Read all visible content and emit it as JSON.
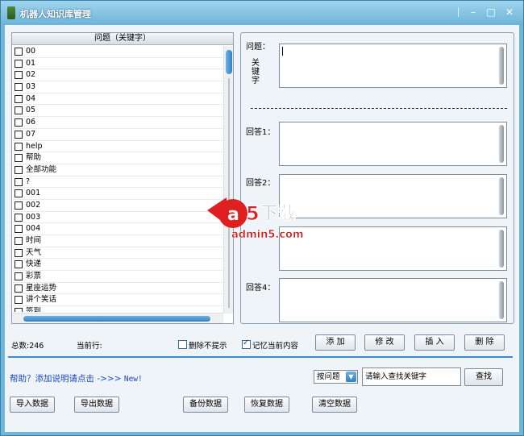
{
  "window": {
    "title": "机器人知识库管理",
    "controls": [
      "–",
      "□",
      "✕"
    ]
  },
  "list": {
    "header": "问题（关键字）",
    "items": [
      "00",
      "01",
      "02",
      "03",
      "04",
      "05",
      "06",
      "07",
      "help",
      "帮助",
      "全部功能",
      "?",
      "001",
      "002",
      "003",
      "004",
      "时间",
      "天气",
      "快递",
      "彩票",
      "星座运势",
      "讲个笑话",
      "签到"
    ]
  },
  "editor": {
    "question_label": "问题：",
    "keyword_label": "关键字",
    "answer1_label": "回答1：",
    "answer2_label": "回答2：",
    "answer4_label": "回答4："
  },
  "status": {
    "total": "总数:246",
    "current_row": "当前行:",
    "delete_no_prompt": "删除不提示",
    "remember_content": "记忆当前内容",
    "remember_checked": true
  },
  "actions": {
    "add": "添 加",
    "modify": "修 改",
    "insert": "插 入",
    "delete": "删 除"
  },
  "help": {
    "text": "帮助？添加说明请点击 ->>> ",
    "new": "New!"
  },
  "search": {
    "mode": "按问题",
    "placeholder": "请输入查找关键字",
    "button": "查找"
  },
  "bottom": {
    "import": "导入数据",
    "export": "导出数据",
    "backup": "备份数据",
    "restore": "恢复数据",
    "clear": "清空数据"
  },
  "watermark": {
    "brand": "下载",
    "site": "admin5.com"
  }
}
